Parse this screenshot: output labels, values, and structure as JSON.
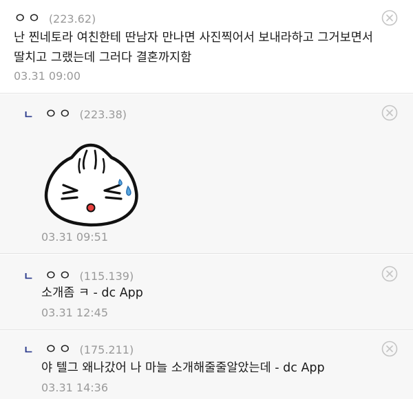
{
  "comments": [
    {
      "nick": "ㅇㅇ",
      "ip": "(223.62)",
      "text_line1": "난 찐네토라 여친한테 딴남자 만나면 사진찍어서 보내라하고 그거보면서",
      "text_line2": "딸치고 그랬는데 그러다 결혼까지함",
      "date": "03.31 09:00"
    },
    {
      "reply_mark": "ㄴ",
      "nick": "ㅇㅇ",
      "ip": "(223.38)",
      "image": "dumpling-emoticon",
      "date": "03.31 09:51"
    },
    {
      "reply_mark": "ㄴ",
      "nick": "ㅇㅇ",
      "ip": "(115.139)",
      "text": "소개좀 ㅋ - dc App",
      "date": "03.31 12:45"
    },
    {
      "reply_mark": "ㄴ",
      "nick": "ㅇㅇ",
      "ip": "(175.211)",
      "text": "야 텔그 왜나갔어 나 마늘 소개해줄줄알았는데 - dc App",
      "date": "03.31 14:36"
    }
  ],
  "icons": {
    "delete": "close-circle-icon",
    "reply": "reply-mark"
  },
  "colors": {
    "reply_mark": "#2b3a8c",
    "reply_background": "#f7f7f7",
    "meta_text": "#9a9a9a"
  }
}
